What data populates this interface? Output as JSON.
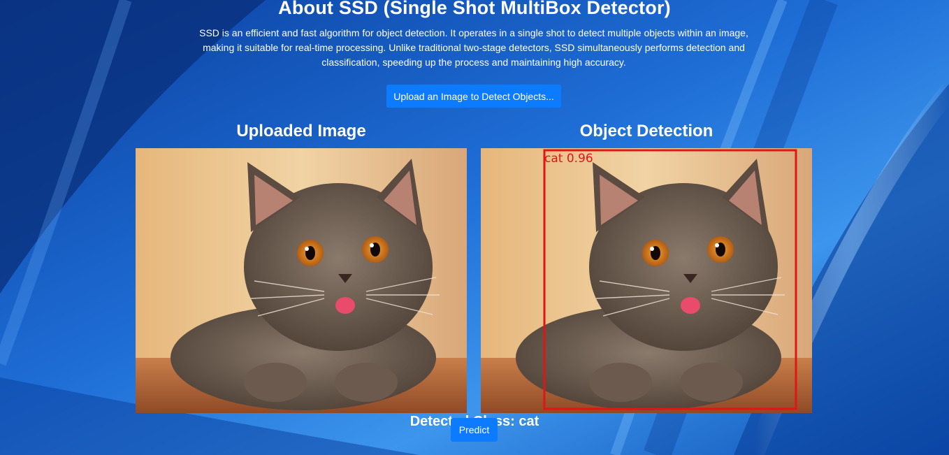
{
  "colors": {
    "background": "#0a47b8",
    "button": "#0d7bff",
    "bounding_box": "#e01515",
    "text": "#ffffff"
  },
  "header": {
    "title": "About SSD (Single Shot MultiBox Detector)",
    "description": "SSD is an efficient and fast algorithm for object detection. It operates in a single shot to detect multiple objects within an image, making it suitable for real-time processing. Unlike traditional two-stage detectors, SSD simultaneously performs detection and classification, speeding up the process and maintaining high accuracy."
  },
  "upload": {
    "label": "Upload an Image to Detect Objects..."
  },
  "panels": {
    "uploaded_heading": "Uploaded Image",
    "detection_heading": "Object Detection"
  },
  "detection": {
    "box_label": "cat 0.96",
    "result_text": "Detected Class: cat"
  },
  "actions": {
    "predict_label": "Predict"
  }
}
